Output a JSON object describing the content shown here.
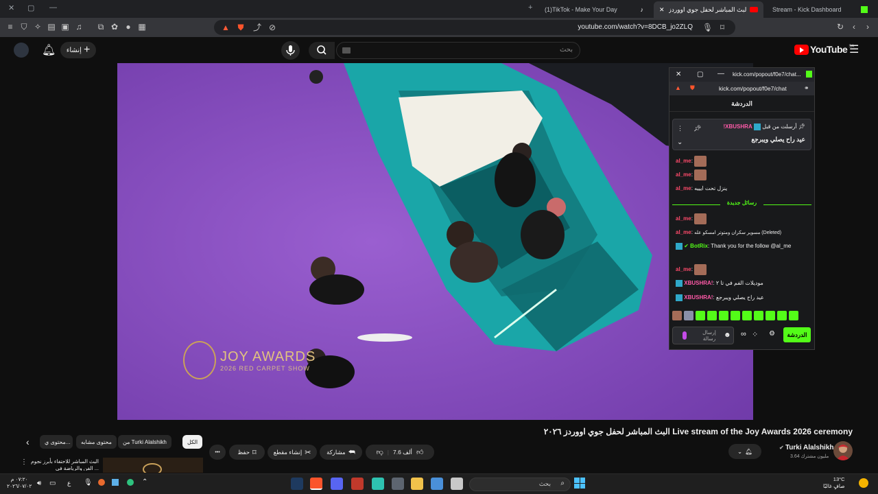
{
  "browser": {
    "tabs": [
      {
        "label": "(1)TikTok - Make Your Day"
      },
      {
        "label": "البث المباشر لحفل جوي اووردز"
      },
      {
        "label": "Stream - Kick Dashboard"
      }
    ],
    "new_tab": "+",
    "url": "youtube.com/watch?v=8DCB_jo2ZLQ",
    "window_controls": [
      "—",
      "▢",
      "✕"
    ],
    "tab_close": "✕"
  },
  "youtube": {
    "logo_text": "YouTube",
    "region": "SA",
    "search_placeholder": "بحث",
    "create_label": "إنشاء",
    "video": {
      "title": "البث المباشر لحفل جوي اووردز ٢٠٢٦ Live stream of the Joy Awards 2026 ceremony",
      "overlay_logo": "JOY AWARDS",
      "overlay_sub": "2026 RED CARPET SHOW"
    },
    "channel": {
      "name": "Turki Alalshikh",
      "subscribers": "3.64 مليون مشترك"
    },
    "actions": {
      "likes": "7.6 ألف",
      "share": "مشاركة",
      "clip": "إنشاء مقطع",
      "save": "حفظ",
      "more": "•••"
    },
    "chips": [
      {
        "label": "الكل",
        "selected": true
      },
      {
        "label": "من Turki Alalshikh",
        "selected": false
      },
      {
        "label": "محتوى مشابه",
        "selected": false
      },
      {
        "label": "محتوى ي...",
        "selected": false
      }
    ],
    "recommendation": {
      "title_line1": "البث المباشر للاحتفاء بأبرز نجوم",
      "title_line2": "الفن والرياضة في ..."
    }
  },
  "chat": {
    "popout_title": "kick.com/popout/f0e7/chat...",
    "popout_url": "kick.com/popout/f0e7/chat",
    "header": "الدردشة",
    "pinned": {
      "label": "أرسلت من قبل",
      "user": "XBUSHRA!",
      "text": "عيد راح يصلي ويبرجع"
    },
    "messages": [
      {
        "user": "al_me",
        "text": "",
        "emote": true
      },
      {
        "user": "al_me",
        "text": "",
        "emote": true
      },
      {
        "user": "al_me",
        "text": "ينزل تحت ايييه"
      }
    ],
    "new_messages_label": "رسائل جديدة",
    "messages_after": [
      {
        "user": "al_me",
        "text": "",
        "emote": true
      },
      {
        "user": "al_me",
        "text": "مسوير سكران ومتوتر امسكو عله (Deleted)"
      },
      {
        "user": "BotRix",
        "text": "Thank you for the follow @al_me"
      },
      {
        "user": "al_me",
        "text": "",
        "emote": true
      },
      {
        "user": "XBUSHRA!",
        "text": "موديلات الفم في تا ٢"
      },
      {
        "user": "XBUSHRA!",
        "text": "عيد راح يصلي ويبرجع"
      }
    ],
    "input_placeholder": "إرسال رسالة",
    "send_label": "الدردشة"
  },
  "taskbar": {
    "search_placeholder": "بحث",
    "time": "٠٧:٢٠ م",
    "date": "٢٠٢٦/٠٧/٠٢",
    "weather_temp": "13°C",
    "weather_desc": "صافٍ غالبًا",
    "lang": "ع"
  },
  "colors": {
    "kick_green": "#53fc18",
    "youtube_red": "#ff0000",
    "carpet_purple": "#8c4fc1",
    "car_teal": "#1aa6a8"
  }
}
